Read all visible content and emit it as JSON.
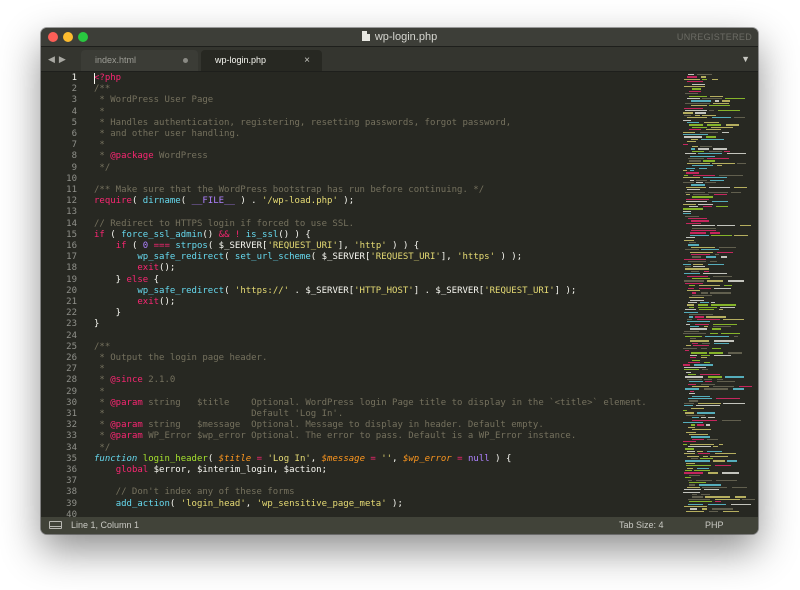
{
  "window": {
    "title": "wp-login.php",
    "license_status": "UNREGISTERED",
    "tab_menu_icon": "chevron-down-icon",
    "nav_icons": [
      "arrow-left-icon",
      "arrow-right-icon"
    ],
    "colors": {
      "titlebar": "#3d3e38",
      "editor_bg": "#272822",
      "status_bar": "#414339",
      "close": "#fc5f57",
      "minimize": "#fdbc2e",
      "maximize": "#29c840"
    }
  },
  "tabs": [
    {
      "label": "index.html",
      "modified": true,
      "active": false
    },
    {
      "label": "wp-login.php",
      "modified": false,
      "active": true,
      "close_symbol": "×"
    }
  ],
  "editor": {
    "theme_colors": {
      "comment": "#75715e",
      "keyword": "#f92672",
      "string": "#e6db74",
      "function": "#66d9ef",
      "declaration": "#a6e22e",
      "constant": "#ae81ff",
      "parameter": "#fd971f"
    },
    "lines": [
      {
        "num": "1",
        "tokens": [
          {
            "t": "<?php",
            "c": "k"
          }
        ]
      },
      {
        "num": "2",
        "tokens": [
          {
            "t": "/**",
            "c": "c"
          }
        ]
      },
      {
        "num": "3",
        "tokens": [
          {
            "t": " * WordPress User Page",
            "c": "c"
          }
        ]
      },
      {
        "num": "4",
        "tokens": [
          {
            "t": " *",
            "c": "c"
          }
        ]
      },
      {
        "num": "5",
        "tokens": [
          {
            "t": " * Handles authentication, registering, resetting passwords, forgot password,",
            "c": "c"
          }
        ]
      },
      {
        "num": "6",
        "tokens": [
          {
            "t": " * and other user handling.",
            "c": "c"
          }
        ]
      },
      {
        "num": "7",
        "tokens": [
          {
            "t": " *",
            "c": "c"
          }
        ]
      },
      {
        "num": "8",
        "tokens": [
          {
            "t": " * ",
            "c": "c"
          },
          {
            "t": "@package",
            "c": "k"
          },
          {
            "t": " WordPress",
            "c": "c"
          }
        ]
      },
      {
        "num": "9",
        "tokens": [
          {
            "t": " */",
            "c": "c"
          }
        ]
      },
      {
        "num": "10",
        "tokens": []
      },
      {
        "num": "11",
        "tokens": [
          {
            "t": "/** Make sure that the WordPress bootstrap has run before continuing. */",
            "c": "c"
          }
        ]
      },
      {
        "num": "12",
        "tokens": [
          {
            "t": "require",
            "c": "k"
          },
          {
            "t": "( ",
            "c": "o"
          },
          {
            "t": "dirname",
            "c": "f"
          },
          {
            "t": "( ",
            "c": "o"
          },
          {
            "t": "__FILE__",
            "c": "n"
          },
          {
            "t": " ) . ",
            "c": "o"
          },
          {
            "t": "'/wp-load.php'",
            "c": "s"
          },
          {
            "t": " );",
            "c": "o"
          }
        ]
      },
      {
        "num": "13",
        "tokens": []
      },
      {
        "num": "14",
        "tokens": [
          {
            "t": "// Redirect to HTTPS login if forced to use SSL.",
            "c": "c"
          }
        ]
      },
      {
        "num": "15",
        "tokens": [
          {
            "t": "if",
            "c": "k"
          },
          {
            "t": " ( ",
            "c": "o"
          },
          {
            "t": "force_ssl_admin",
            "c": "f"
          },
          {
            "t": "() ",
            "c": "o"
          },
          {
            "t": "&&",
            "c": "k"
          },
          {
            "t": " ",
            "c": "o"
          },
          {
            "t": "!",
            "c": "k"
          },
          {
            "t": " ",
            "c": "o"
          },
          {
            "t": "is_ssl",
            "c": "f"
          },
          {
            "t": "() ) {",
            "c": "o"
          }
        ]
      },
      {
        "num": "16",
        "tokens": [
          {
            "t": "    ",
            "c": "o"
          },
          {
            "t": "if",
            "c": "k"
          },
          {
            "t": " ( ",
            "c": "o"
          },
          {
            "t": "0",
            "c": "n"
          },
          {
            "t": " ",
            "c": "o"
          },
          {
            "t": "===",
            "c": "k"
          },
          {
            "t": " ",
            "c": "o"
          },
          {
            "t": "strpos",
            "c": "f"
          },
          {
            "t": "( $_SERVER[",
            "c": "o"
          },
          {
            "t": "'REQUEST_URI'",
            "c": "s"
          },
          {
            "t": "], ",
            "c": "o"
          },
          {
            "t": "'http'",
            "c": "s"
          },
          {
            "t": " ) ) {",
            "c": "o"
          }
        ]
      },
      {
        "num": "17",
        "tokens": [
          {
            "t": "        ",
            "c": "o"
          },
          {
            "t": "wp_safe_redirect",
            "c": "f"
          },
          {
            "t": "( ",
            "c": "o"
          },
          {
            "t": "set_url_scheme",
            "c": "f"
          },
          {
            "t": "( $_SERVER[",
            "c": "o"
          },
          {
            "t": "'REQUEST_URI'",
            "c": "s"
          },
          {
            "t": "], ",
            "c": "o"
          },
          {
            "t": "'https'",
            "c": "s"
          },
          {
            "t": " ) );",
            "c": "o"
          }
        ]
      },
      {
        "num": "18",
        "tokens": [
          {
            "t": "        ",
            "c": "o"
          },
          {
            "t": "exit",
            "c": "k"
          },
          {
            "t": "();",
            "c": "o"
          }
        ]
      },
      {
        "num": "19",
        "tokens": [
          {
            "t": "    } ",
            "c": "o"
          },
          {
            "t": "else",
            "c": "k"
          },
          {
            "t": " {",
            "c": "o"
          }
        ]
      },
      {
        "num": "20",
        "tokens": [
          {
            "t": "        ",
            "c": "o"
          },
          {
            "t": "wp_safe_redirect",
            "c": "f"
          },
          {
            "t": "( ",
            "c": "o"
          },
          {
            "t": "'https://'",
            "c": "s"
          },
          {
            "t": " . $_SERVER[",
            "c": "o"
          },
          {
            "t": "'HTTP_HOST'",
            "c": "s"
          },
          {
            "t": "] . $_SERVER[",
            "c": "o"
          },
          {
            "t": "'REQUEST_URI'",
            "c": "s"
          },
          {
            "t": "] );",
            "c": "o"
          }
        ]
      },
      {
        "num": "21",
        "tokens": [
          {
            "t": "        ",
            "c": "o"
          },
          {
            "t": "exit",
            "c": "k"
          },
          {
            "t": "();",
            "c": "o"
          }
        ]
      },
      {
        "num": "22",
        "tokens": [
          {
            "t": "    }",
            "c": "o"
          }
        ]
      },
      {
        "num": "23",
        "tokens": [
          {
            "t": "}",
            "c": "o"
          }
        ]
      },
      {
        "num": "24",
        "tokens": []
      },
      {
        "num": "25",
        "tokens": [
          {
            "t": "/**",
            "c": "c"
          }
        ]
      },
      {
        "num": "26",
        "tokens": [
          {
            "t": " * Output the login page header.",
            "c": "c"
          }
        ]
      },
      {
        "num": "27",
        "tokens": [
          {
            "t": " *",
            "c": "c"
          }
        ]
      },
      {
        "num": "28",
        "tokens": [
          {
            "t": " * ",
            "c": "c"
          },
          {
            "t": "@since",
            "c": "k"
          },
          {
            "t": " 2.1.0",
            "c": "c"
          }
        ]
      },
      {
        "num": "29",
        "tokens": [
          {
            "t": " *",
            "c": "c"
          }
        ]
      },
      {
        "num": "30",
        "tokens": [
          {
            "t": " * ",
            "c": "c"
          },
          {
            "t": "@param",
            "c": "k"
          },
          {
            "t": " string   $title    Optional. WordPress login Page title to display in the `<title>` element.",
            "c": "c"
          }
        ]
      },
      {
        "num": "31",
        "tokens": [
          {
            "t": " *                           Default 'Log In'.",
            "c": "c"
          }
        ]
      },
      {
        "num": "32",
        "tokens": [
          {
            "t": " * ",
            "c": "c"
          },
          {
            "t": "@param",
            "c": "k"
          },
          {
            "t": " string   $message  Optional. Message to display in header. Default empty.",
            "c": "c"
          }
        ]
      },
      {
        "num": "33",
        "tokens": [
          {
            "t": " * ",
            "c": "c"
          },
          {
            "t": "@param",
            "c": "k"
          },
          {
            "t": " WP_Error $wp_error Optional. The error to pass. Default is a WP_Error instance.",
            "c": "c"
          }
        ]
      },
      {
        "num": "34",
        "tokens": [
          {
            "t": " */",
            "c": "c"
          }
        ]
      },
      {
        "num": "35",
        "tokens": [
          {
            "t": "function",
            "c": "t"
          },
          {
            "t": " ",
            "c": "o"
          },
          {
            "t": "login_header",
            "c": "g"
          },
          {
            "t": "( ",
            "c": "o"
          },
          {
            "t": "$title",
            "c": "p"
          },
          {
            "t": " ",
            "c": "o"
          },
          {
            "t": "=",
            "c": "k"
          },
          {
            "t": " ",
            "c": "o"
          },
          {
            "t": "'Log In'",
            "c": "s"
          },
          {
            "t": ", ",
            "c": "o"
          },
          {
            "t": "$message",
            "c": "p"
          },
          {
            "t": " ",
            "c": "o"
          },
          {
            "t": "=",
            "c": "k"
          },
          {
            "t": " ",
            "c": "o"
          },
          {
            "t": "''",
            "c": "s"
          },
          {
            "t": ", ",
            "c": "o"
          },
          {
            "t": "$wp_error",
            "c": "p"
          },
          {
            "t": " ",
            "c": "o"
          },
          {
            "t": "=",
            "c": "k"
          },
          {
            "t": " ",
            "c": "o"
          },
          {
            "t": "null",
            "c": "n"
          },
          {
            "t": " ) {",
            "c": "o"
          }
        ]
      },
      {
        "num": "36",
        "tokens": [
          {
            "t": "    ",
            "c": "o"
          },
          {
            "t": "global",
            "c": "k"
          },
          {
            "t": " $error, $interim_login, $action;",
            "c": "o"
          }
        ]
      },
      {
        "num": "37",
        "tokens": []
      },
      {
        "num": "38",
        "tokens": [
          {
            "t": "    // Don't index any of these forms",
            "c": "c"
          }
        ]
      },
      {
        "num": "39",
        "tokens": [
          {
            "t": "    ",
            "c": "o"
          },
          {
            "t": "add_action",
            "c": "f"
          },
          {
            "t": "( ",
            "c": "o"
          },
          {
            "t": "'login_head'",
            "c": "s"
          },
          {
            "t": ", ",
            "c": "o"
          },
          {
            "t": "'wp_sensitive_page_meta'",
            "c": "s"
          },
          {
            "t": " );",
            "c": "o"
          }
        ]
      },
      {
        "num": "40",
        "tokens": []
      }
    ]
  },
  "status_bar": {
    "panel_icon": "panel-toggle-icon",
    "position": "Line 1, Column 1",
    "tab_size": "Tab Size: 4",
    "syntax": "PHP"
  }
}
